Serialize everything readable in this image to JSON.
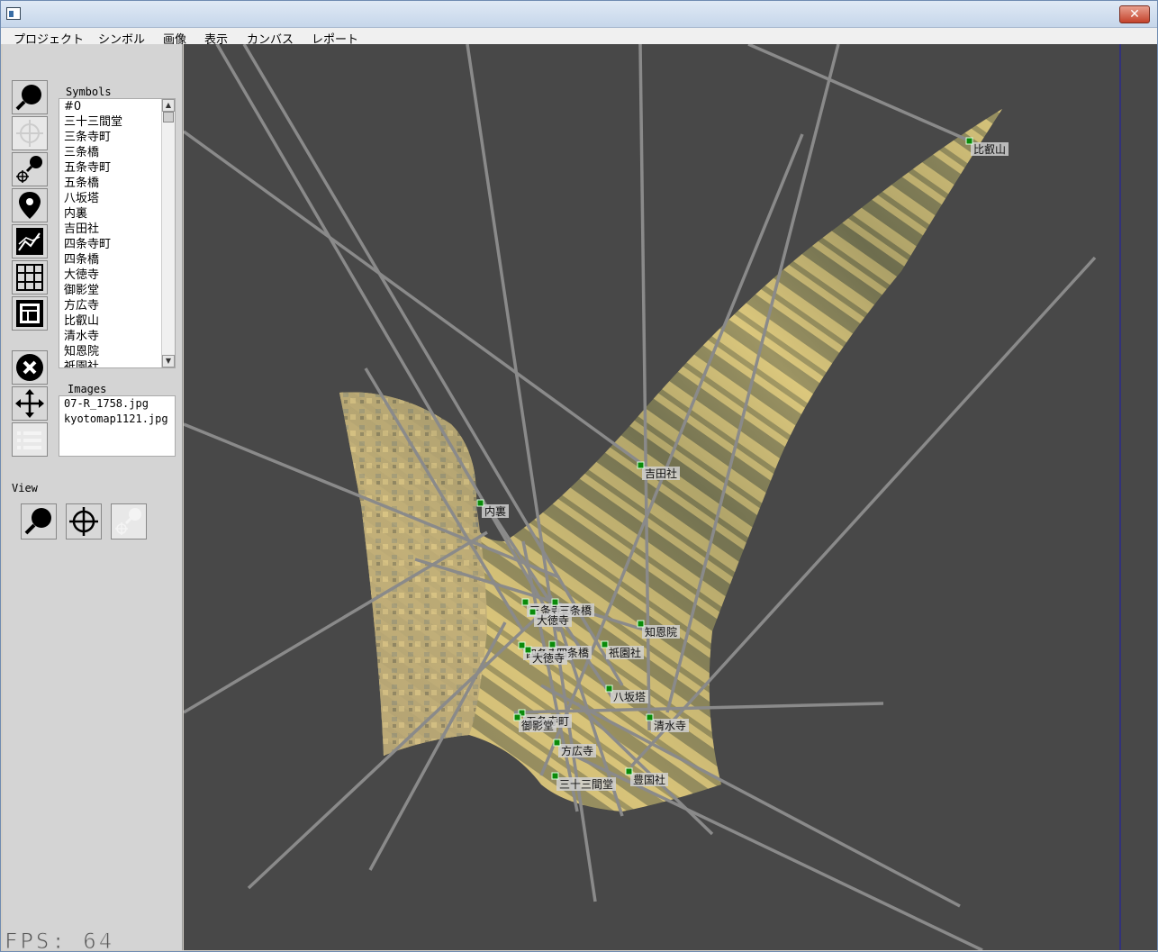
{
  "window": {
    "close_label": "✕"
  },
  "menu": [
    "プロジェクト",
    "シンボル",
    "画像",
    "表示",
    "カンバス",
    "レポート"
  ],
  "symbols_panel": {
    "label": "Symbols",
    "items": [
      "#0",
      "三十三間堂",
      "三条寺町",
      "三条橋",
      "五条寺町",
      "五条橋",
      "八坂塔",
      "内裏",
      "吉田社",
      "四条寺町",
      "四条橋",
      "大徳寺",
      "御影堂",
      "方広寺",
      "比叡山",
      "清水寺",
      "知恩院",
      "祇園社"
    ]
  },
  "images_panel": {
    "label": "Images",
    "items": [
      "07-R_1758.jpg",
      "kyotomap1121.jpg"
    ]
  },
  "view_panel": {
    "label": "View"
  },
  "tools": [
    "zoom-tool",
    "crosshair-tool",
    "zoom-crosshair-tool",
    "pin-tool",
    "chart-tool",
    "grid-tool",
    "layout-tool",
    "delete-tool",
    "move-tool",
    "list-tool"
  ],
  "view_tools": [
    "zoom-view",
    "crosshair-view",
    "zoom-crosshair-view"
  ],
  "canvas": {
    "markers": [
      {
        "label": "比叡山"
      },
      {
        "label": "吉田社"
      },
      {
        "label": "内裏"
      },
      {
        "label": "三条寺町"
      },
      {
        "label": "三条橋"
      },
      {
        "label": "大徳寺"
      },
      {
        "label": "知恩院"
      },
      {
        "label": "四条寺町"
      },
      {
        "label": "四条橋"
      },
      {
        "label": "大徳寺"
      },
      {
        "label": "祇園社"
      },
      {
        "label": "八坂塔"
      },
      {
        "label": "五条寺町"
      },
      {
        "label": "御影堂"
      },
      {
        "label": "清水寺"
      },
      {
        "label": "方広寺"
      },
      {
        "label": "豊国社"
      },
      {
        "label": "三十三間堂"
      }
    ],
    "colors": {
      "background": "#484848",
      "line": "#8a8a8a",
      "marker": "#0a8a0a",
      "label_bg": "#d0d0d0"
    }
  },
  "status": {
    "fps_label": "FPS:",
    "fps_value": "64"
  }
}
